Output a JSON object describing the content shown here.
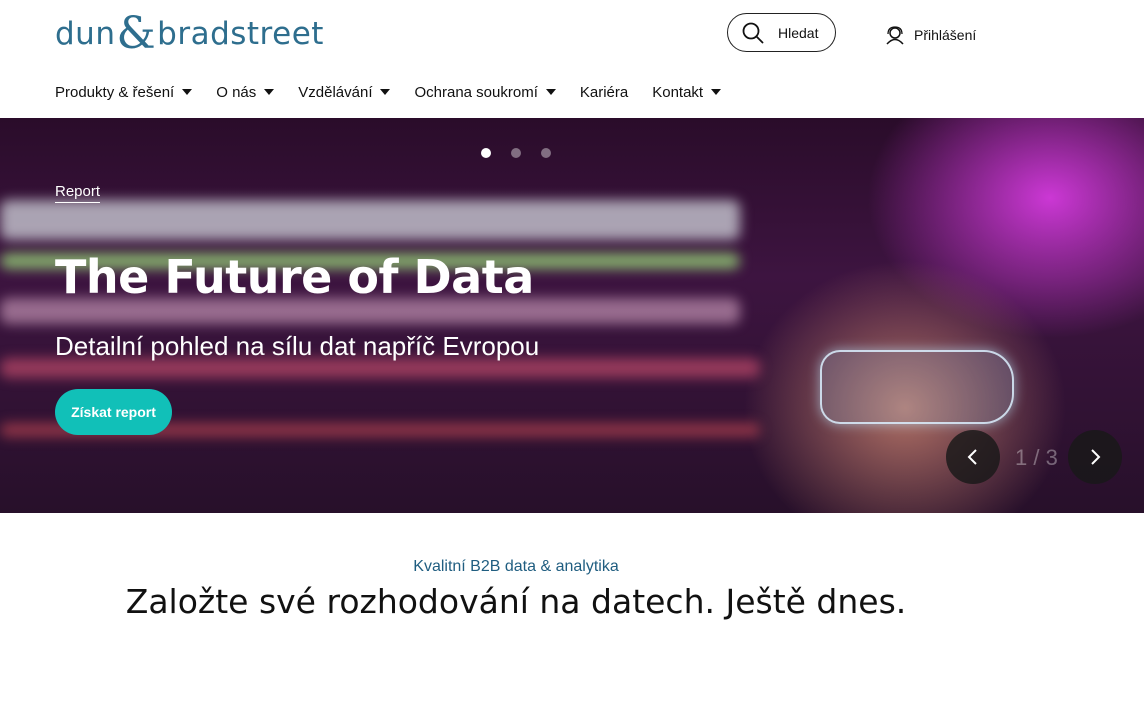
{
  "brand": {
    "logo_word1": "dun",
    "logo_amp": "&",
    "logo_word2": "bradstreet",
    "color": "#2e6e8e"
  },
  "header": {
    "search_label": "Hledat",
    "search_icon": "search-icon",
    "login_label": "Přihlášení",
    "login_icon": "user-icon"
  },
  "nav": {
    "items": [
      {
        "label": "Produkty & řešení",
        "dropdown": true
      },
      {
        "label": "O nás",
        "dropdown": true
      },
      {
        "label": "Vzdělávání",
        "dropdown": true
      },
      {
        "label": "Ochrana soukromí",
        "dropdown": true
      },
      {
        "label": "Kariéra",
        "dropdown": false
      },
      {
        "label": "Kontakt",
        "dropdown": true
      }
    ]
  },
  "hero": {
    "eyebrow": "Report",
    "title": "The Future of Data",
    "subtitle": "Detailní pohled na sílu dat napříč Evropou",
    "cta_label": "Získat report",
    "cta_color": "#11c0b8",
    "slide_counter": "1 / 3",
    "slides_total": 3,
    "active_slide": 1
  },
  "section": {
    "tagline": "Kvalitní B2B data & analytika",
    "headline": "Založte své rozhodování na datech. Ještě dnes."
  }
}
